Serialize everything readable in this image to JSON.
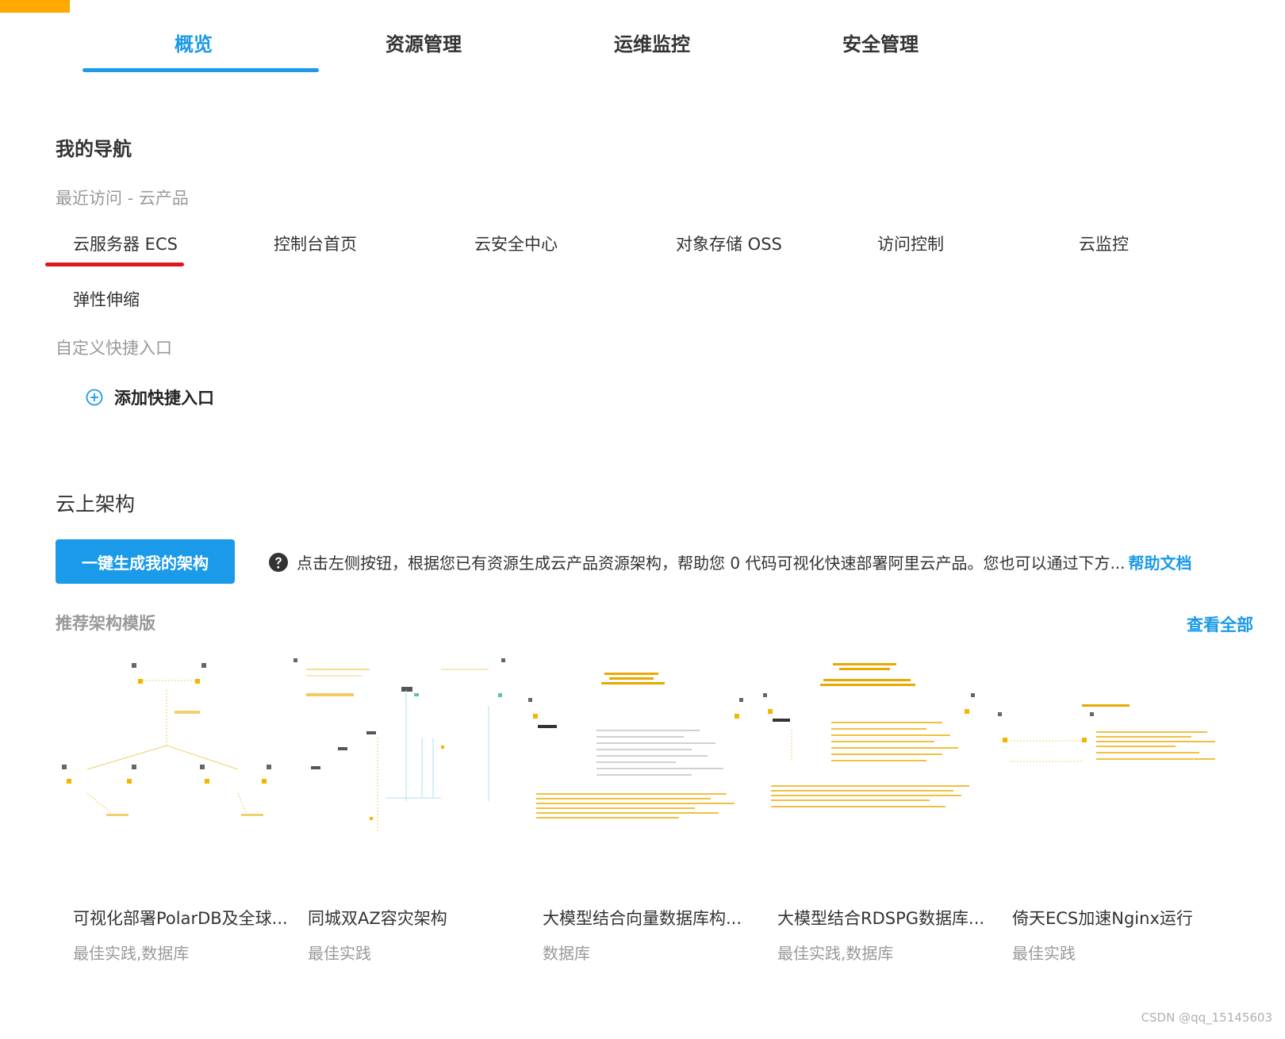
{
  "tabs": [
    {
      "label": "概览",
      "active": true
    },
    {
      "label": "资源管理",
      "active": false
    },
    {
      "label": "运维监控",
      "active": false
    },
    {
      "label": "安全管理",
      "active": false
    }
  ],
  "my_nav": {
    "title": "我的导航",
    "recent_label": "最近访问 - 云产品",
    "recent_items": [
      "云服务器 ECS",
      "控制台首页",
      "云安全中心",
      "对象存储 OSS",
      "访问控制",
      "云监控",
      "弹性伸缩"
    ],
    "custom_label": "自定义快捷入口",
    "add_entry": "添加快捷入口"
  },
  "architecture": {
    "title": "云上架构",
    "generate_button": "一键生成我的架构",
    "help_text": "点击左侧按钮，根据您已有资源生成云产品资源架构，帮助您 0 代码可视化快速部署阿里云产品。您也可以通过下方...",
    "help_link": "帮助文档",
    "recommended_title": "推荐架构模版",
    "view_all": "查看全部",
    "templates": [
      {
        "name": "可视化部署PolarDB及全球...",
        "tags": "最佳实践,数据库"
      },
      {
        "name": "同城双AZ容灾架构",
        "tags": "最佳实践"
      },
      {
        "name": "大模型结合向量数据库构...",
        "tags": "数据库"
      },
      {
        "name": "大模型结合RDSPG数据库...",
        "tags": "最佳实践,数据库"
      },
      {
        "name": "倚天ECS加速Nginx运行",
        "tags": "最佳实践"
      }
    ]
  },
  "colors": {
    "accent": "#1a9ae8",
    "highlight_underline": "#e0141e",
    "corner": "#ffa800"
  },
  "watermark": "CSDN @qq_15145603"
}
